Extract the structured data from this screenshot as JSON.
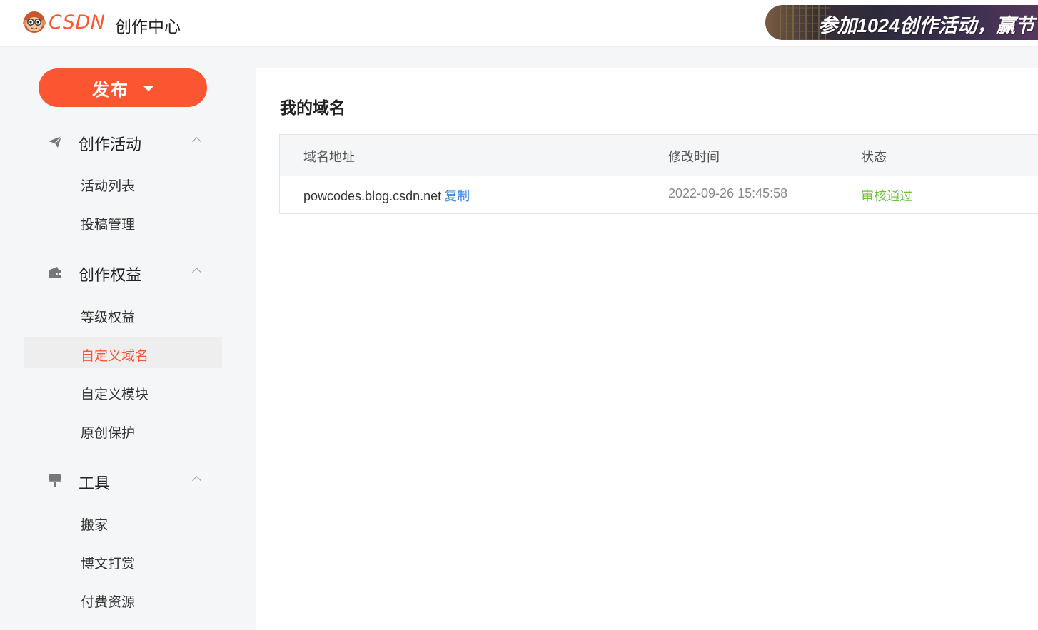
{
  "header": {
    "logo_text": "CSDN",
    "title": "创作中心",
    "banner_text": "参加1024创作活动，赢节"
  },
  "sidebar": {
    "publish_label": "发布",
    "groups": [
      {
        "label": "创作活动",
        "icon": "paper-plane-icon",
        "items": [
          {
            "label": "活动列表"
          },
          {
            "label": "投稿管理"
          }
        ]
      },
      {
        "label": "创作权益",
        "icon": "wallet-icon",
        "items": [
          {
            "label": "等级权益"
          },
          {
            "label": "自定义域名",
            "active": true
          },
          {
            "label": "自定义模块"
          },
          {
            "label": "原创保护"
          }
        ]
      },
      {
        "label": "工具",
        "icon": "paint-brush-icon",
        "items": [
          {
            "label": "搬家"
          },
          {
            "label": "博文打赏"
          },
          {
            "label": "付费资源"
          }
        ]
      }
    ]
  },
  "main": {
    "title": "我的域名",
    "table": {
      "columns": [
        "域名地址",
        "修改时间",
        "状态"
      ],
      "rows": [
        {
          "domain": "powcodes.blog.csdn.net",
          "copy_label": "复制",
          "modified": "2022-09-26 15:45:58",
          "status": "审核通过"
        }
      ]
    }
  },
  "colors": {
    "brand": "#fc5531",
    "link": "#3d8ce0",
    "success": "#67c23a"
  }
}
